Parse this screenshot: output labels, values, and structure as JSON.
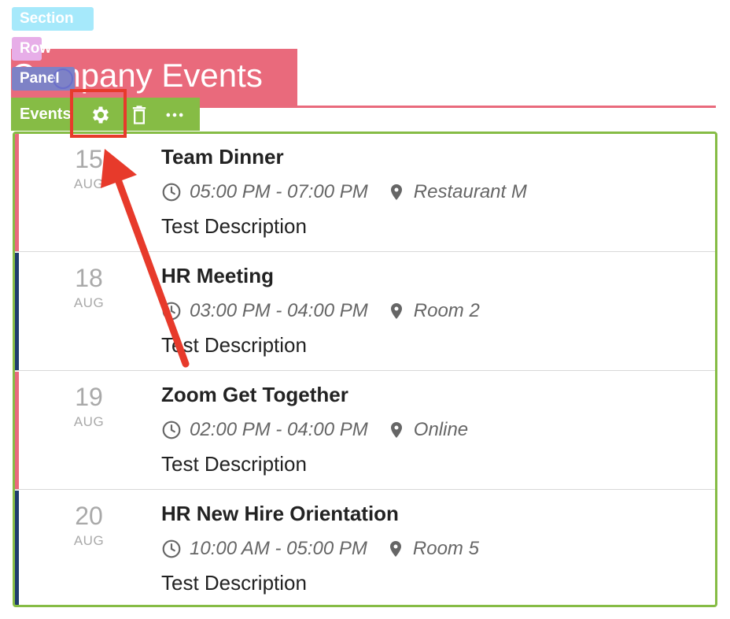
{
  "editor": {
    "section_label": "Section",
    "row_label": "Row",
    "panel_label": "Panel",
    "toolbar_label": "Events",
    "tools": [
      "gear-icon",
      "trash-icon",
      "more-icon"
    ]
  },
  "page": {
    "title": "Company Events",
    "accent_color": "#e96a7c",
    "frame_color": "#86bc45"
  },
  "events": [
    {
      "day": "15",
      "month": "AUG",
      "title": "Team Dinner",
      "time": "05:00 PM - 07:00 PM",
      "location": "Restaurant M",
      "description": "Test Description",
      "accent": "#e96a7c"
    },
    {
      "day": "18",
      "month": "AUG",
      "title": "HR Meeting",
      "time": "03:00 PM - 04:00 PM",
      "location": "Room 2",
      "description": "Test Description",
      "accent": "#1f3c6e"
    },
    {
      "day": "19",
      "month": "AUG",
      "title": "Zoom Get Together",
      "time": "02:00 PM - 04:00 PM",
      "location": "Online",
      "description": "Test Description",
      "accent": "#e96a7c"
    },
    {
      "day": "20",
      "month": "AUG",
      "title": "HR New Hire Orientation",
      "time": "10:00 AM - 05:00 PM",
      "location": "Room 5",
      "description": "Test Description",
      "accent": "#1f3c6e"
    }
  ],
  "annotation": {
    "color": "#e73a2b"
  }
}
